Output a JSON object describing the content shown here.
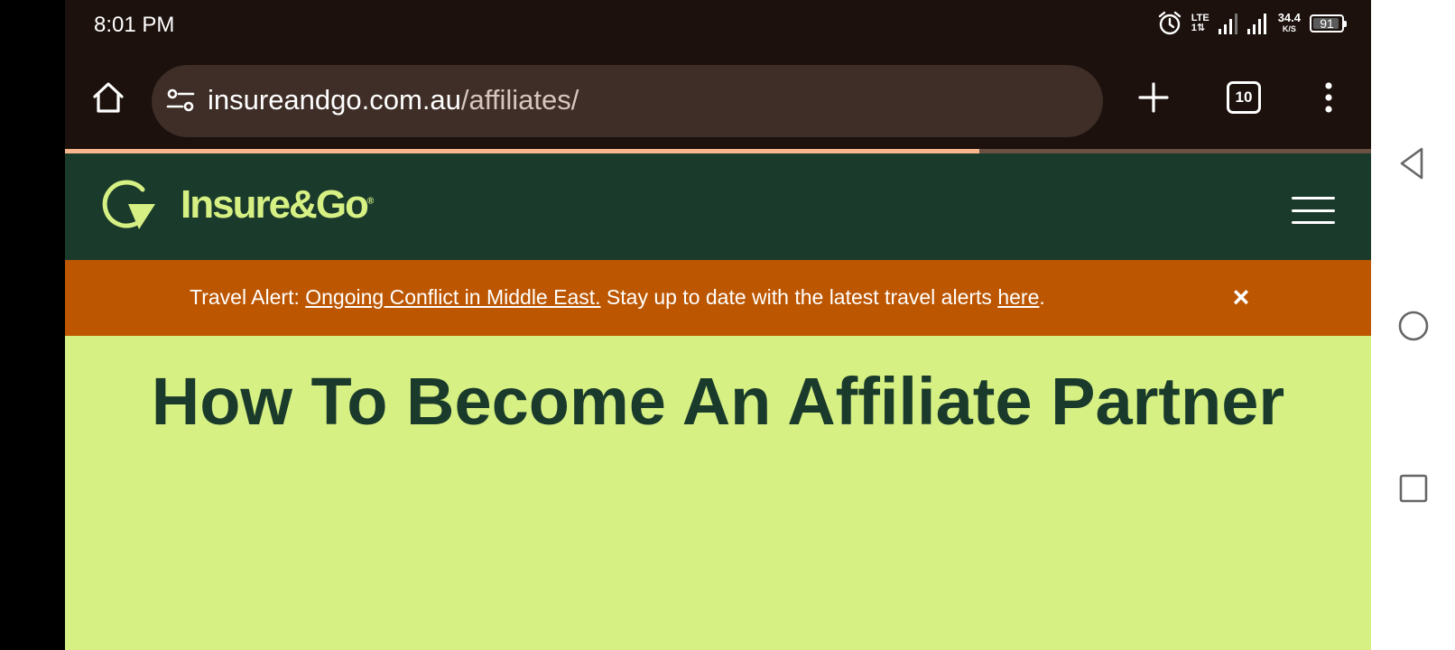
{
  "status_bar": {
    "time": "8:01 PM",
    "lte_top": "LTE",
    "lte_bottom": "1⇅",
    "speed_value": "34.4",
    "speed_unit": "K/S",
    "battery": "91"
  },
  "browser": {
    "url_domain": "insureandgo.com.au",
    "url_path": "/affiliates/",
    "tab_count": "10",
    "load_progress": 0.7
  },
  "site": {
    "logo_text": "Insure&Go",
    "logo_mark": "®"
  },
  "alert": {
    "prefix": "Travel Alert: ",
    "link1": "Ongoing Conflict in Middle East.",
    "middle": " Stay up to date with the latest travel alerts ",
    "link2": "here",
    "suffix": ".",
    "close": "×"
  },
  "hero": {
    "title": "How To Become An Affiliate Partner"
  },
  "colors": {
    "header_bg": "#1a3a2b",
    "brand_lime": "#d6f083",
    "alert_bg": "#bc5600",
    "browser_bg": "#1c110d"
  },
  "icons": {
    "home": "home-icon",
    "site_settings": "tune-icon",
    "new_tab": "plus-icon",
    "menu": "more-vert-icon",
    "hamburger": "hamburger-menu-icon",
    "close": "close-icon"
  }
}
